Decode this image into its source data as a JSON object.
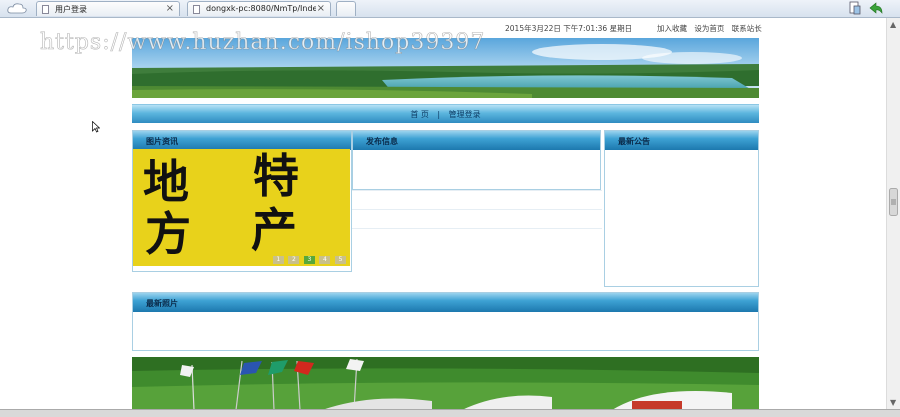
{
  "browser": {
    "tabs": [
      {
        "label": "用户登录",
        "close": "×"
      },
      {
        "label": "dongxk-pc:8080/NmTp/Inde",
        "close": "×"
      }
    ]
  },
  "header": {
    "datetime": "2015年3月22日  下午7:01:36  星期日",
    "links": [
      "加入收藏",
      "设为首页",
      "联系站长"
    ]
  },
  "nav": {
    "items": [
      "首 页",
      "|",
      "管理登录"
    ]
  },
  "panels": {
    "photo_news": "图片资讯",
    "publish_info": "发布信息",
    "latest_notice": "最新公告",
    "latest_photos": "最新照片"
  },
  "photo": {
    "chars": [
      "地",
      "特",
      "方",
      "产"
    ],
    "slides": [
      "1",
      "2",
      "3",
      "4",
      "5"
    ]
  },
  "watermark": "https://www.huzhan.com/ishop39397",
  "colors": {
    "nav_blue": "#2f8cc0",
    "panel_border": "#a9cfe3",
    "photo_yellow": "#e8d21b"
  }
}
